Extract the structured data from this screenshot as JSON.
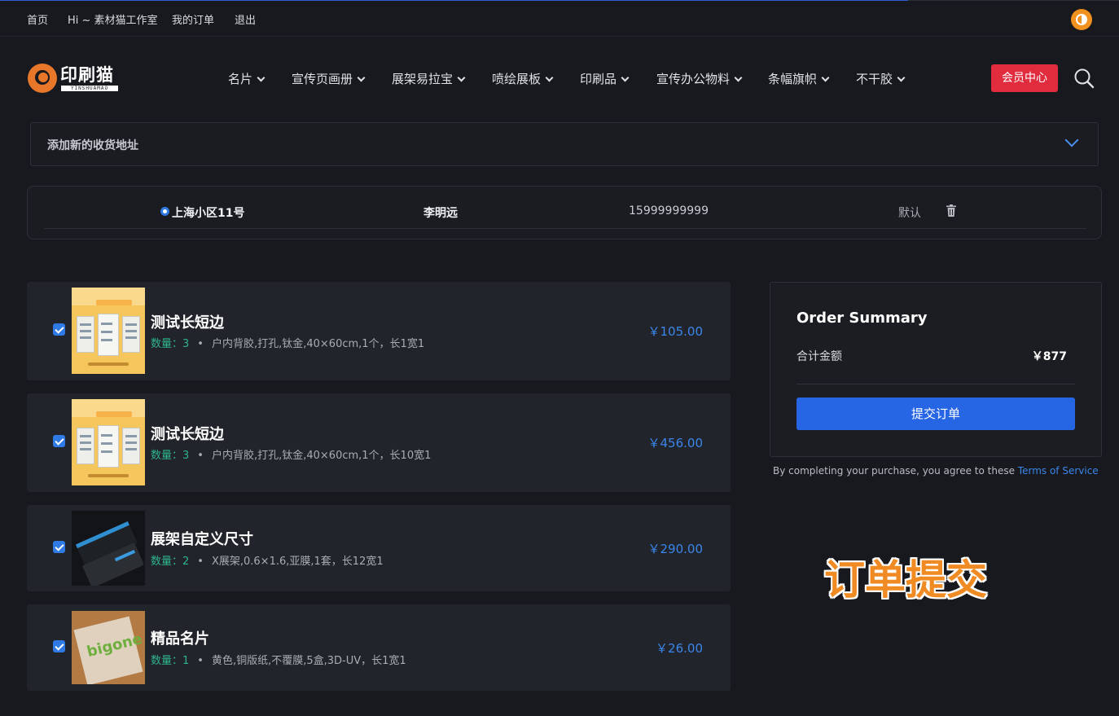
{
  "topbar": {
    "links": [
      "首页",
      "Hi ~ 素材猫工作室",
      "我的订单",
      "退出"
    ]
  },
  "brand": {
    "name": "印刷猫",
    "sub": "YINSHUAMAO",
    "accent": "#e8772a"
  },
  "nav": {
    "items": [
      "名片",
      "宣传页画册",
      "展架易拉宝",
      "喷绘展板",
      "印刷品",
      "宣传办公物料",
      "条幅旗帜",
      "不干胶"
    ],
    "member_button": "会员中心"
  },
  "address": {
    "add_label": "添加新的收货地址",
    "rows": [
      {
        "address": "上海小区11号",
        "name": "李明远",
        "phone": "15999999999",
        "default": "默认"
      }
    ]
  },
  "cart": {
    "qty_label": "数量：",
    "items": [
      {
        "title": "测试长短边",
        "qty": "3",
        "spec": "户内背胶,打孔,钛金,40×60cm,1个，长1宽1",
        "price": "￥105.00",
        "thumb": "display-board-image"
      },
      {
        "title": "测试长短边",
        "qty": "3",
        "spec": "户内背胶,打孔,钛金,40×60cm,1个，长10宽1",
        "price": "￥456.00",
        "thumb": "display-board-image"
      },
      {
        "title": "展架自定义尺寸",
        "qty": "2",
        "spec": "X展架,0.6×1.6,亚膜,1套，长12宽1",
        "price": "￥290.00",
        "thumb": "business-cards-image"
      },
      {
        "title": "精品名片",
        "qty": "1",
        "spec": "黄色,铜版纸,不覆膜,5盒,3D-UV，长1宽1",
        "price": "￥26.00",
        "thumb": "frosted-card-image",
        "thumb_text": "bigone"
      }
    ]
  },
  "summary": {
    "title": "Order Summary",
    "total_label": "合计金额",
    "total_value": "￥877",
    "submit": "提交订单",
    "terms_text": "By completing your purchase, you agree to these ",
    "terms_link": "Terms of Service"
  },
  "caption": "订单提交",
  "colors": {
    "background": "#18191e",
    "primary": "#2665e4",
    "danger": "#e02c3d",
    "price": "#3a86ea",
    "qty": "#2eb48b"
  }
}
